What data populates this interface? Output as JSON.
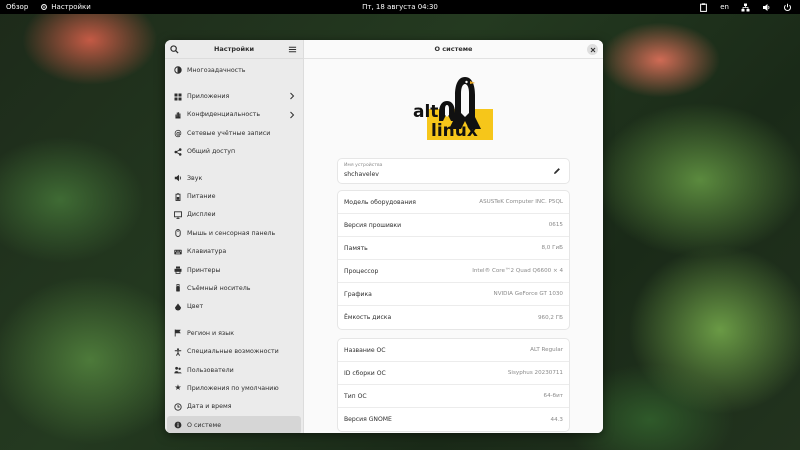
{
  "topbar": {
    "overview": "Обзор",
    "app_name": "Настройки",
    "datetime": "Пт, 18 августа  04:30",
    "language": "en"
  },
  "sidebar": {
    "title": "Настройки",
    "items": [
      {
        "label": "Многозадачность",
        "icon": "multitasking-icon"
      },
      {
        "label": "Приложения",
        "icon": "apps-icon",
        "chevron": true
      },
      {
        "label": "Конфиденциальность",
        "icon": "hand-icon",
        "chevron": true
      },
      {
        "label": "Сетевые учётные записи",
        "icon": "at-icon"
      },
      {
        "label": "Общий доступ",
        "icon": "share-icon"
      },
      {
        "label": "Звук",
        "icon": "speaker-icon"
      },
      {
        "label": "Питание",
        "icon": "battery-icon"
      },
      {
        "label": "Дисплеи",
        "icon": "display-icon"
      },
      {
        "label": "Мышь и сенсорная панель",
        "icon": "mouse-icon"
      },
      {
        "label": "Клавиатура",
        "icon": "keyboard-icon"
      },
      {
        "label": "Принтеры",
        "icon": "printer-icon"
      },
      {
        "label": "Съёмный носитель",
        "icon": "usb-icon"
      },
      {
        "label": "Цвет",
        "icon": "color-icon"
      },
      {
        "label": "Регион и язык",
        "icon": "flag-icon"
      },
      {
        "label": "Специальные возможности",
        "icon": "accessibility-icon"
      },
      {
        "label": "Пользователи",
        "icon": "users-icon"
      },
      {
        "label": "Приложения по умолчанию",
        "icon": "star-icon"
      },
      {
        "label": "Дата и время",
        "icon": "clock-icon"
      },
      {
        "label": "О системе",
        "icon": "info-icon",
        "active": true
      }
    ]
  },
  "main": {
    "title": "О системе",
    "logo": {
      "line1": "alt",
      "line2": "linux"
    },
    "device_name_label": "Имя устройства",
    "device_name": "shchavelev",
    "hardware": [
      {
        "label": "Модель оборудования",
        "value": "ASUSTeK Computer INC. P5QL"
      },
      {
        "label": "Версия прошивки",
        "value": "0615"
      },
      {
        "label": "Память",
        "value": "8,0 ГиБ"
      },
      {
        "label": "Процессор",
        "value": "Intel® Core™2 Quad Q6600 × 4"
      },
      {
        "label": "Графика",
        "value": "NVIDIA GeForce GT 1030"
      },
      {
        "label": "Ёмкость диска",
        "value": "960,2 ГБ"
      }
    ],
    "os": [
      {
        "label": "Название ОС",
        "value": "ALT Regular"
      },
      {
        "label": "ID сборки ОС",
        "value": "Sisyphus 20230711"
      },
      {
        "label": "Тип ОС",
        "value": "64-бит"
      },
      {
        "label": "Версия GNOME",
        "value": "44.3"
      }
    ]
  }
}
